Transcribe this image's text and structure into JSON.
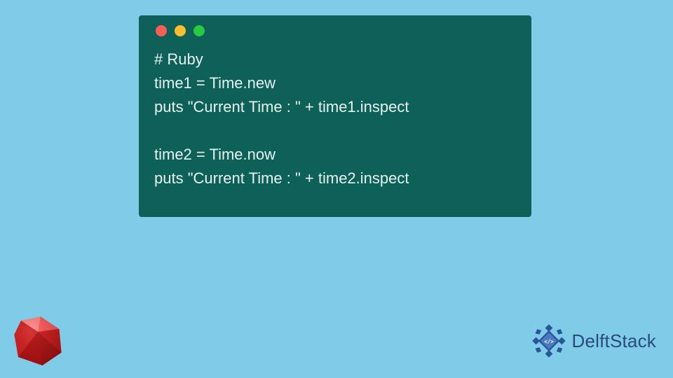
{
  "code": {
    "lines": [
      "# Ruby",
      "time1 = Time.new",
      "puts \"Current Time : \" + time1.inspect",
      "",
      "time2 = Time.now",
      "puts \"Current Time : \" + time2.inspect"
    ]
  },
  "brand": {
    "name": "DelftStack"
  }
}
